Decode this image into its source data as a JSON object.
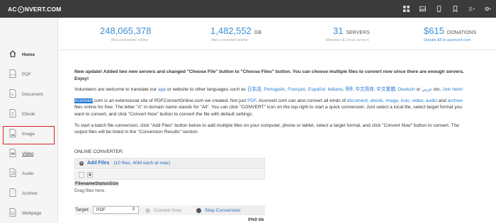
{
  "header": {
    "logo_left": "AC",
    "logo_right": "NVERT.COM",
    "icons": [
      "grid-icon",
      "image-icon",
      "mobile-icon",
      "bookmark-icon",
      "language-icon",
      "settings-icon"
    ]
  },
  "sidebar": {
    "items": [
      {
        "label": "Home",
        "icon": "home-icon"
      },
      {
        "label": "PDF",
        "icon": "pdf-icon"
      },
      {
        "label": "Document",
        "icon": "document-icon"
      },
      {
        "label": "Ebook",
        "icon": "ebook-icon"
      },
      {
        "label": "Image",
        "icon": "image-file-icon"
      },
      {
        "label": "Video",
        "icon": "video-icon"
      },
      {
        "label": "Audio",
        "icon": "audio-icon"
      },
      {
        "label": "Archive",
        "icon": "archive-icon"
      },
      {
        "label": "Webpage",
        "icon": "webpage-icon"
      }
    ],
    "highlight_color": "#e02020"
  },
  "stats": [
    {
      "value": "248,065,378",
      "unit": "",
      "caption": "files converted online"
    },
    {
      "value": "1,482,552",
      "unit": "GB",
      "caption": "files converted online"
    },
    {
      "value": "31",
      "unit": "SERVERS",
      "caption": "Windows & Linux servers"
    },
    {
      "value": "$615",
      "unit": "DONATIONS",
      "caption": "Donate $5 to aconvert.com"
    }
  ],
  "content": {
    "news": "New update! Added two new servers and changed \"Choose File\" button to \"Choose Files\" button. You can choose multiple files to convert now since there are enough servers. Enjoy!",
    "p1_a": "Volunteers are welcome to translate our ",
    "p1_app": "app",
    "p1_b": " or website to other languages such as ",
    "p1_langs": "日本語, Português, Français, Español, Italiano, हिंदी, 中文简体, 中文繁體, Deutsch",
    "p1_c": " or ",
    "p1_ar": "عربي",
    "p1_d": " etc. ",
    "p1_join": "Join here!",
    "p2_hl": "Aconvert",
    "p2_a": ".com is an extensional site of PDFConvertOnline.com we created. Not just ",
    "p2_pdf": "PDF",
    "p2_b": ", Aconvert.com can also convert all kinds of ",
    "p2_types": "document, ebook, image, icon, video, audio",
    "p2_and": " and ",
    "p2_archive": "archive",
    "p2_c": " files online for free. The letter \"A\" in domain name stands for \"All\". You can click \"CONVERT\" icon on the top-right to start a quick conversion: Just select a local file, select target format you want to convert, and click \"Convert Now\" button to convert the file with default settings.",
    "p3": "To start a batch file conversion, click \"Add Files\" button below to add multiple files on your computer, phone or tablet, select a target format, and click \"Convert Now\" button to convert. The output files will be listed in the \"Conversion Results\" section."
  },
  "converter": {
    "section_title": "ONLINE CONVERTER:",
    "add_files_label": "Add Files",
    "add_files_note": "(10 files, 40M each at max)",
    "columns_header": "FilenameStatusSize",
    "drag_text": "Drag files here.",
    "target_label": "Target:",
    "target_value": "PDF",
    "convert_now_label": "Convert Now",
    "stop_label": "Stop Conversion",
    "progress_text": "0%0 kb"
  }
}
